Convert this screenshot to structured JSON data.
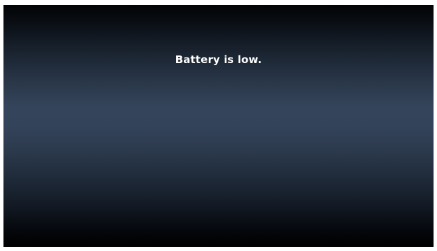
{
  "dialog": {
    "message": "Battery is low."
  },
  "colors": {
    "background_top": "#020304",
    "background_middle": "#34445a",
    "background_bottom": "#000000",
    "text": "#ffffff"
  }
}
